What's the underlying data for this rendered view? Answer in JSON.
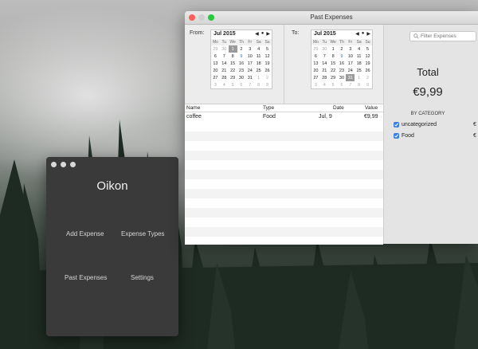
{
  "colors": {
    "accent": "#3b7fe0",
    "close": "#fc5f57",
    "minimize": "#d0d0d0",
    "zoom": "#28c840"
  },
  "oikon": {
    "title": "Oikon",
    "buttons": {
      "add_expense": "Add Expense",
      "expense_types": "Expense Types",
      "past_expenses": "Past Expenses",
      "settings": "Settings"
    }
  },
  "past_expenses": {
    "window_title": "Past Expenses",
    "from_label": "From:",
    "to_label": "To:",
    "weekdays": [
      "Mo",
      "Tu",
      "We",
      "Th",
      "Fr",
      "Sa",
      "Su"
    ],
    "from_calendar": {
      "month": "Jul 2015",
      "weeks": [
        [
          {
            "d": "29",
            "o": 1
          },
          {
            "d": "30",
            "o": 1
          },
          {
            "d": "1",
            "s": 1
          },
          {
            "d": "2"
          },
          {
            "d": "3"
          },
          {
            "d": "4"
          },
          {
            "d": "5"
          }
        ],
        [
          {
            "d": "6"
          },
          {
            "d": "7"
          },
          {
            "d": "8"
          },
          {
            "d": "9",
            "t": 1
          },
          {
            "d": "10"
          },
          {
            "d": "11"
          },
          {
            "d": "12"
          }
        ],
        [
          {
            "d": "13"
          },
          {
            "d": "14"
          },
          {
            "d": "15"
          },
          {
            "d": "16"
          },
          {
            "d": "17"
          },
          {
            "d": "18"
          },
          {
            "d": "19"
          }
        ],
        [
          {
            "d": "20"
          },
          {
            "d": "21"
          },
          {
            "d": "22"
          },
          {
            "d": "23"
          },
          {
            "d": "24"
          },
          {
            "d": "25"
          },
          {
            "d": "26"
          }
        ],
        [
          {
            "d": "27"
          },
          {
            "d": "28"
          },
          {
            "d": "29"
          },
          {
            "d": "30"
          },
          {
            "d": "31"
          },
          {
            "d": "1",
            "o": 1
          },
          {
            "d": "2",
            "o": 1
          }
        ],
        [
          {
            "d": "3",
            "o": 1
          },
          {
            "d": "4",
            "o": 1
          },
          {
            "d": "5",
            "o": 1
          },
          {
            "d": "6",
            "o": 1
          },
          {
            "d": "7",
            "o": 1
          },
          {
            "d": "8",
            "o": 1
          },
          {
            "d": "9",
            "o": 1
          }
        ]
      ]
    },
    "to_calendar": {
      "month": "Jul 2015",
      "weeks": [
        [
          {
            "d": "29",
            "o": 1
          },
          {
            "d": "30",
            "o": 1
          },
          {
            "d": "1"
          },
          {
            "d": "2"
          },
          {
            "d": "3"
          },
          {
            "d": "4"
          },
          {
            "d": "5"
          }
        ],
        [
          {
            "d": "6"
          },
          {
            "d": "7"
          },
          {
            "d": "8"
          },
          {
            "d": "9",
            "t": 1
          },
          {
            "d": "10"
          },
          {
            "d": "11"
          },
          {
            "d": "12"
          }
        ],
        [
          {
            "d": "13"
          },
          {
            "d": "14"
          },
          {
            "d": "15"
          },
          {
            "d": "16"
          },
          {
            "d": "17"
          },
          {
            "d": "18"
          },
          {
            "d": "19"
          }
        ],
        [
          {
            "d": "20"
          },
          {
            "d": "21"
          },
          {
            "d": "22"
          },
          {
            "d": "23"
          },
          {
            "d": "24"
          },
          {
            "d": "25"
          },
          {
            "d": "26"
          }
        ],
        [
          {
            "d": "27"
          },
          {
            "d": "28"
          },
          {
            "d": "29"
          },
          {
            "d": "30"
          },
          {
            "d": "31",
            "s": 1
          },
          {
            "d": "1",
            "o": 1
          },
          {
            "d": "2",
            "o": 1
          }
        ],
        [
          {
            "d": "3",
            "o": 1
          },
          {
            "d": "4",
            "o": 1
          },
          {
            "d": "5",
            "o": 1
          },
          {
            "d": "6",
            "o": 1
          },
          {
            "d": "7",
            "o": 1
          },
          {
            "d": "8",
            "o": 1
          },
          {
            "d": "9",
            "o": 1
          }
        ]
      ]
    },
    "table": {
      "columns": [
        "Name",
        "Type",
        "Date",
        "Value"
      ],
      "rows": [
        {
          "name": "coffee",
          "type": "Food",
          "date": "Jul, 9",
          "value": "€9,99"
        }
      ]
    },
    "search_placeholder": "Filter Expenses",
    "total_label": "Total",
    "total_value": "€9,99",
    "by_category_label": "BY CATEGORY",
    "categories": [
      {
        "name": "uncategorized",
        "value": "€",
        "checked": true
      },
      {
        "name": "Food",
        "value": "€",
        "checked": true
      }
    ]
  }
}
